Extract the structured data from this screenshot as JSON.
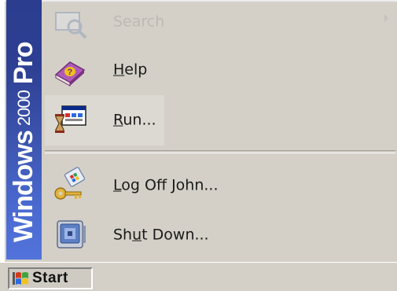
{
  "banner": {
    "brand": "Windows",
    "version": "2000",
    "edition": "Pro"
  },
  "menu": {
    "items": [
      {
        "label": "Search",
        "icon": "search-icon",
        "state": "faded"
      },
      {
        "label_pre": "",
        "label_accel": "H",
        "label_post": "elp",
        "icon": "help-book-icon"
      },
      {
        "label_pre": "",
        "label_accel": "R",
        "label_post": "un...",
        "icon": "run-icon"
      },
      {
        "label_pre": "",
        "label_accel": "L",
        "label_post": "og Off John...",
        "icon": "log-off-key-icon"
      },
      {
        "label_pre": "Sh",
        "label_accel": "u",
        "label_post": "t Down...",
        "icon": "shut-down-icon"
      }
    ]
  },
  "taskbar": {
    "start_label": "Start",
    "start_icon": "windows-flag-icon"
  },
  "colors": {
    "menu_bg": "#d4d0c8",
    "banner_top": "#2a3d8f",
    "banner_bottom": "#5273db"
  }
}
